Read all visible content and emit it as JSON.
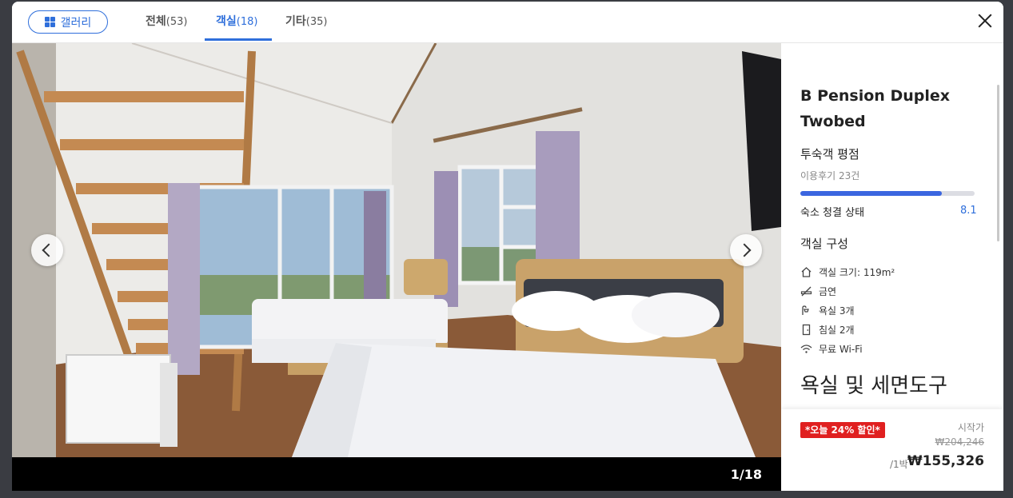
{
  "header": {
    "gallery_label": "갤러리",
    "tabs": [
      {
        "label": "전체",
        "count": "(53)"
      },
      {
        "label": "객실",
        "count": "(18)"
      },
      {
        "label": "기타",
        "count": "(35)"
      }
    ]
  },
  "photo": {
    "counter": "1/18"
  },
  "panel": {
    "room_name": "B Pension Duplex Twobed",
    "rating_title": "투숙객 평점",
    "review_count": "이용후기 23건",
    "clean_label": "숙소 청결 상태",
    "clean_score": "8.1",
    "clean_fraction": 0.81,
    "room_section_title": "객실 구성",
    "amenities": [
      {
        "icon": "house-icon",
        "label": "객실 크기: 119m²"
      },
      {
        "icon": "no-smoking-icon",
        "label": "금연"
      },
      {
        "icon": "shower-icon",
        "label": "욕실 3개"
      },
      {
        "icon": "door-icon",
        "label": "침실 2개"
      },
      {
        "icon": "wifi-icon",
        "label": "무료 Wi-Fi"
      }
    ],
    "bath_title": "욕실 및 세면도구"
  },
  "price": {
    "discount_badge": "*오늘 24% 할인*",
    "from_label": "시작가",
    "original_price": "₩204,246",
    "per_night": "/1박",
    "final_price": "₩155,326"
  },
  "colors": {
    "accent": "#2f6fdb",
    "discount": "#e02020",
    "rating_bar": "#3b66e0"
  }
}
